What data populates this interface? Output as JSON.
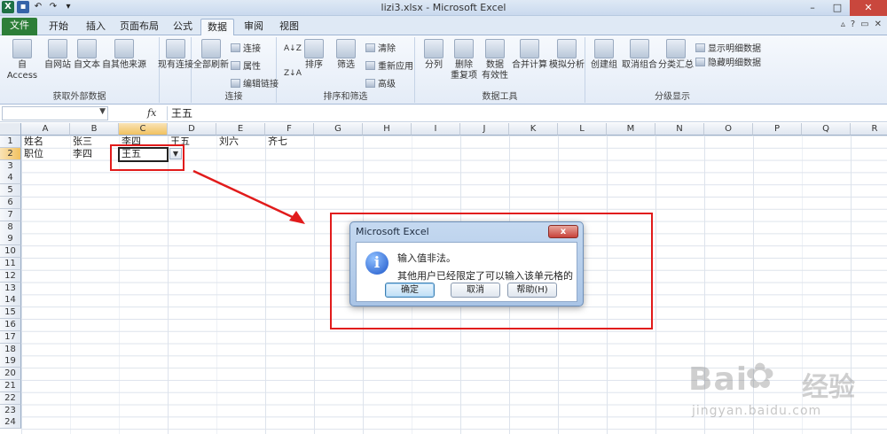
{
  "window": {
    "file_title": "lizi3.xlsx",
    "separator": " - ",
    "app_title": "Microsoft Excel"
  },
  "tabs": [
    {
      "label": "文件"
    },
    {
      "label": "开始"
    },
    {
      "label": "插入"
    },
    {
      "label": "页面布局"
    },
    {
      "label": "公式"
    },
    {
      "label": "数据"
    },
    {
      "label": "审阅"
    },
    {
      "label": "视图"
    }
  ],
  "ribbon": {
    "groups": {
      "external": "获取外部数据",
      "connections": "连接",
      "sort_filter": "排序和筛选",
      "data_tools": "数据工具",
      "outline": "分级显示"
    },
    "buttons": {
      "from_access": "自 Access",
      "from_web": "自网站",
      "from_text": "自文本",
      "from_other": "自其他来源",
      "existing": "现有连接",
      "refresh_all": "全部刷新",
      "connections": "连接",
      "properties": "属性",
      "edit_links": "编辑链接",
      "sort": "排序",
      "filter": "筛选",
      "clear": "清除",
      "reapply": "重新应用",
      "advanced": "高级",
      "text_to_columns": "分列",
      "remove_duplicates_1": "删除",
      "remove_duplicates_2": "重复项",
      "validation_1": "数据",
      "validation_2": "有效性",
      "consolidate": "合并计算",
      "what_if": "模拟分析",
      "group": "创建组",
      "ungroup": "取消组合",
      "subtotal": "分类汇总",
      "show_detail": "显示明细数据",
      "hide_detail": "隐藏明细数据"
    }
  },
  "formula_bar": {
    "fx": "fx",
    "value": "王五"
  },
  "columns": [
    "A",
    "B",
    "C",
    "D",
    "E",
    "F",
    "G",
    "H",
    "I",
    "J",
    "K",
    "L",
    "M",
    "N",
    "O",
    "P",
    "Q",
    "R"
  ],
  "rows": [
    "1",
    "2",
    "3",
    "4",
    "5",
    "6",
    "7",
    "8",
    "9",
    "10",
    "11",
    "12",
    "13",
    "14",
    "15",
    "16",
    "17",
    "18",
    "19",
    "20",
    "21",
    "22",
    "23",
    "24"
  ],
  "cells": {
    "A1": "姓名",
    "B1": "张三",
    "C1": "李四",
    "D1": "王五",
    "E1": "刘六",
    "F1": "齐七",
    "A2": "职位",
    "B2": "李四",
    "C2": "王五"
  },
  "dialog": {
    "title": "Microsoft Excel",
    "close": "x",
    "message_1": "输入值非法。",
    "message_2": "其他用户已经限定了可以输入该单元格的数值。",
    "ok": "确定",
    "cancel": "取消",
    "help": "帮助(H)"
  },
  "watermark": {
    "brand": "Bai",
    "brand_cn": "经验",
    "url": "jingyan.baidu.com"
  },
  "colors": {
    "file_tab": "#2d7e38",
    "annotation": "#e11b1b",
    "selection_header": "#f1c15f"
  }
}
